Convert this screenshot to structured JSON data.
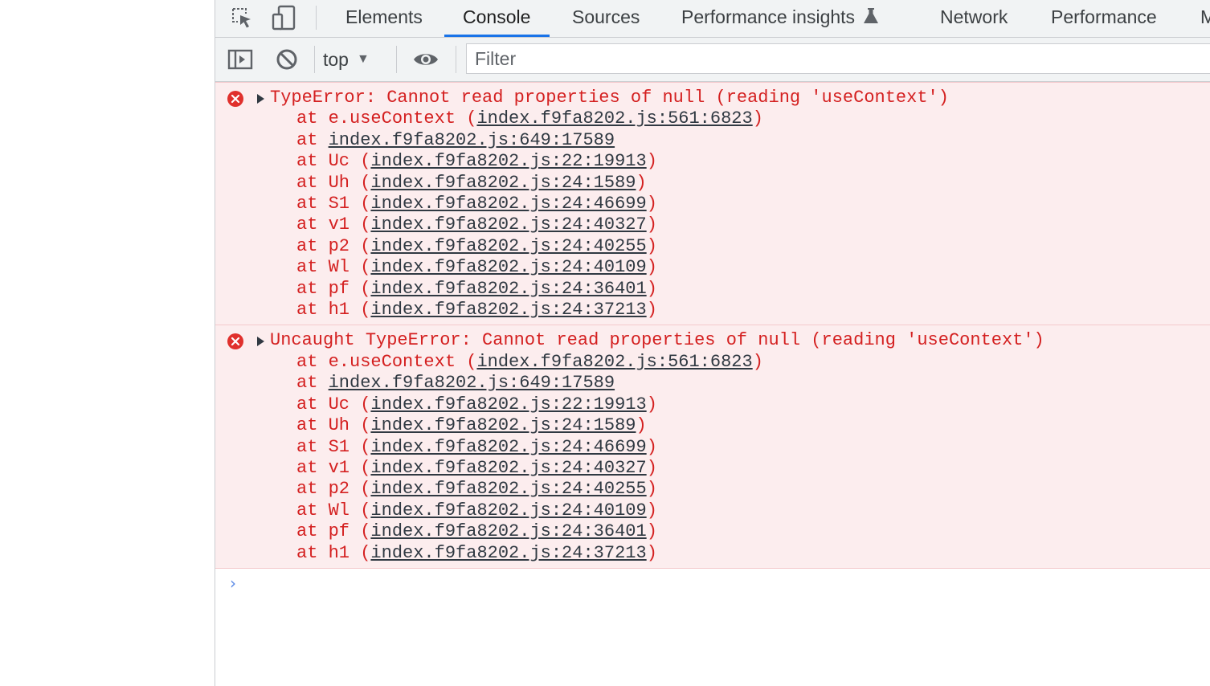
{
  "tabs": [
    {
      "label": "Elements",
      "active": false
    },
    {
      "label": "Console",
      "active": true
    },
    {
      "label": "Sources",
      "active": false
    },
    {
      "label": "Performance insights",
      "active": false
    },
    {
      "label": "Network",
      "active": false
    },
    {
      "label": "Performance",
      "active": false
    },
    {
      "label": "M",
      "active": false
    }
  ],
  "toolbar": {
    "context": "top",
    "filter_placeholder": "Filter"
  },
  "colors": {
    "error_text": "#d42020",
    "error_bg": "#fcedee",
    "active_tab_underline": "#1a73e8",
    "link": "#303942"
  },
  "messages": [
    {
      "level": "error",
      "text": "TypeError: Cannot read properties of null (reading 'useContext')",
      "frames": [
        {
          "fn": "e.useContext",
          "loc": "index.f9fa8202.js:561:6823"
        },
        {
          "fn": "",
          "loc": "index.f9fa8202.js:649:17589"
        },
        {
          "fn": "Uc",
          "loc": "index.f9fa8202.js:22:19913"
        },
        {
          "fn": "Uh",
          "loc": "index.f9fa8202.js:24:1589"
        },
        {
          "fn": "S1",
          "loc": "index.f9fa8202.js:24:46699"
        },
        {
          "fn": "v1",
          "loc": "index.f9fa8202.js:24:40327"
        },
        {
          "fn": "p2",
          "loc": "index.f9fa8202.js:24:40255"
        },
        {
          "fn": "Wl",
          "loc": "index.f9fa8202.js:24:40109"
        },
        {
          "fn": "pf",
          "loc": "index.f9fa8202.js:24:36401"
        },
        {
          "fn": "h1",
          "loc": "index.f9fa8202.js:24:37213"
        }
      ]
    },
    {
      "level": "error",
      "text": "Uncaught TypeError: Cannot read properties of null (reading 'useContext')",
      "frames": [
        {
          "fn": "e.useContext",
          "loc": "index.f9fa8202.js:561:6823"
        },
        {
          "fn": "",
          "loc": "index.f9fa8202.js:649:17589"
        },
        {
          "fn": "Uc",
          "loc": "index.f9fa8202.js:22:19913"
        },
        {
          "fn": "Uh",
          "loc": "index.f9fa8202.js:24:1589"
        },
        {
          "fn": "S1",
          "loc": "index.f9fa8202.js:24:46699"
        },
        {
          "fn": "v1",
          "loc": "index.f9fa8202.js:24:40327"
        },
        {
          "fn": "p2",
          "loc": "index.f9fa8202.js:24:40255"
        },
        {
          "fn": "Wl",
          "loc": "index.f9fa8202.js:24:40109"
        },
        {
          "fn": "pf",
          "loc": "index.f9fa8202.js:24:36401"
        },
        {
          "fn": "h1",
          "loc": "index.f9fa8202.js:24:37213"
        }
      ]
    }
  ]
}
